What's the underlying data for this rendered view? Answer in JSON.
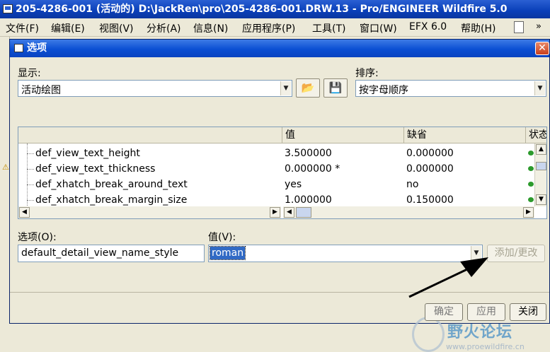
{
  "app": {
    "title": "205-4286-001 (活动的) D:\\JackRen\\pro\\205-4286-001.DRW.13 - Pro/ENGINEER Wildfire 5.0",
    "menu": [
      "文件(F)",
      "编辑(E)",
      "视图(V)",
      "分析(A)",
      "信息(N)",
      "应用程序(P)",
      "工具(T)",
      "窗口(W)",
      "EFX 6.0",
      "帮助(H)"
    ],
    "overflow_glyph": "»"
  },
  "dialog": {
    "title": "选项",
    "close_glyph": "✕",
    "display_label": "显示:",
    "display_value": "活动绘图",
    "sort_label": "排序:",
    "sort_value": "按字母顺序",
    "table": {
      "columns": [
        "",
        "值",
        "缺省",
        "状态"
      ],
      "rows": [
        {
          "name": "def_view_text_height",
          "value": "3.500000",
          "default": "0.000000"
        },
        {
          "name": "def_view_text_thickness",
          "value": "0.000000 *",
          "default": "0.000000"
        },
        {
          "name": "def_xhatch_break_around_text",
          "value": "yes",
          "default": "no"
        },
        {
          "name": "def_xhatch_break_margin_size",
          "value": "1.000000",
          "default": "0.150000"
        }
      ],
      "status_color": "#2c9a2c"
    },
    "option_label": "选项(O):",
    "option_value": "default_detail_view_name_style",
    "value_label": "值(V):",
    "value_selected": "roman",
    "add_change_button": "添加/更改",
    "ok_button": "确定",
    "apply_button": "应用",
    "close_button": "关闭"
  },
  "watermark": {
    "title": "野火论坛",
    "url": "www.proewildfire.cn"
  },
  "colors": {
    "titlebar": "#0a3fb8",
    "selection": "#316ac5",
    "dialog_bg": "#ece9d8"
  }
}
